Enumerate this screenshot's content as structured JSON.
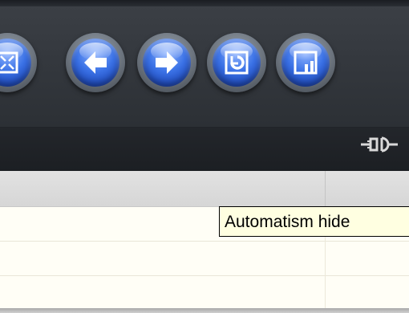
{
  "toolbar": {
    "buttons": [
      {
        "id": "fullscreen",
        "icon": "fullscreen-icon"
      },
      {
        "id": "back",
        "icon": "arrow-left-icon"
      },
      {
        "id": "forward",
        "icon": "arrow-right-icon"
      },
      {
        "id": "refresh",
        "icon": "refresh-icon"
      },
      {
        "id": "stats",
        "icon": "bar-chart-icon"
      }
    ],
    "accent_color": "#2f63d8"
  },
  "status_bar": {
    "connection_icon": "plug-connection-icon"
  },
  "list": {
    "rows": [
      "",
      "",
      ""
    ]
  },
  "tooltip": {
    "text": "Automatism hide"
  }
}
